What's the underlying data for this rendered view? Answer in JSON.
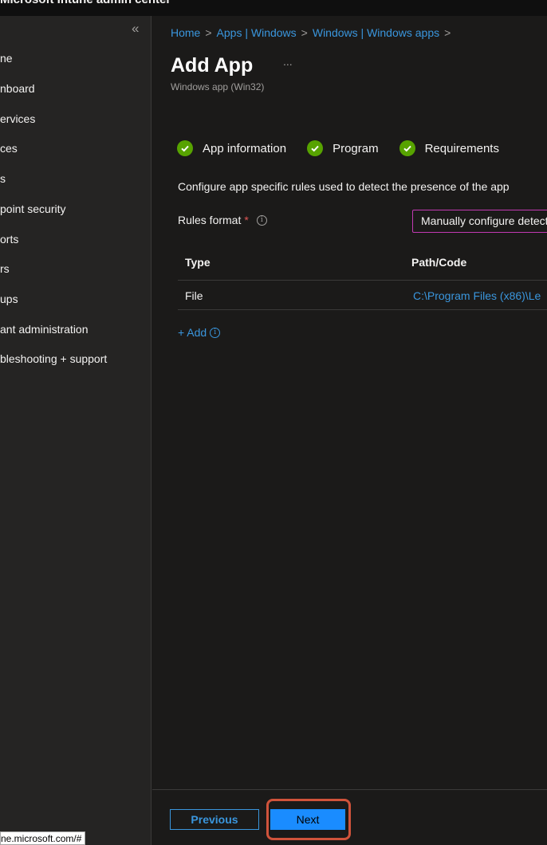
{
  "app": {
    "title": "Microsoft Intune admin center",
    "status_url": "ne.microsoft.com/#"
  },
  "sidebar": {
    "collapse_glyph": "«",
    "items": [
      {
        "label": "ne",
        "full": "Home"
      },
      {
        "label": "nboard",
        "full": "Dashboard"
      },
      {
        "label": "ervices",
        "full": "All services"
      },
      {
        "label": "ces",
        "full": "Devices"
      },
      {
        "label": "s",
        "full": "Apps"
      },
      {
        "label": "point security",
        "full": "Endpoint security"
      },
      {
        "label": "orts",
        "full": "Reports"
      },
      {
        "label": "rs",
        "full": "Users"
      },
      {
        "label": "ups",
        "full": "Groups"
      },
      {
        "label": "ant administration",
        "full": "Tenant administration"
      },
      {
        "label": "bleshooting + support",
        "full": "Troubleshooting + support"
      }
    ]
  },
  "breadcrumb": [
    {
      "label": "Home"
    },
    {
      "label": "Apps | Windows"
    },
    {
      "label": "Windows | Windows apps"
    }
  ],
  "breadcrumb_sep": ">",
  "page": {
    "title": "Add App",
    "more_glyph": "...",
    "subtitle": "Windows app (Win32)"
  },
  "steps": [
    {
      "label": "App information",
      "status": "complete"
    },
    {
      "label": "Program",
      "status": "complete"
    },
    {
      "label": "Requirements",
      "status": "complete"
    }
  ],
  "detection": {
    "description": "Configure app specific rules used to detect the presence of the app",
    "rules_format_label": "Rules format",
    "required_mark": "*",
    "info_glyph": "i",
    "rules_format_value": "Manually configure detection rules"
  },
  "table": {
    "columns": [
      "Type",
      "Path/Code"
    ],
    "rows": [
      {
        "type": "File",
        "path": "C:\\Program Files (x86)\\Le"
      }
    ]
  },
  "add_label": "+ Add",
  "footer": {
    "previous_label": "Previous",
    "next_label": "Next"
  },
  "colors": {
    "background": "#1b1a19",
    "sidebar": "#252423",
    "link": "#3a96dd",
    "primary_button": "#1a8cff",
    "success": "#57a300",
    "highlight": "#d0533b",
    "dropdown_border": "#c239b3"
  }
}
